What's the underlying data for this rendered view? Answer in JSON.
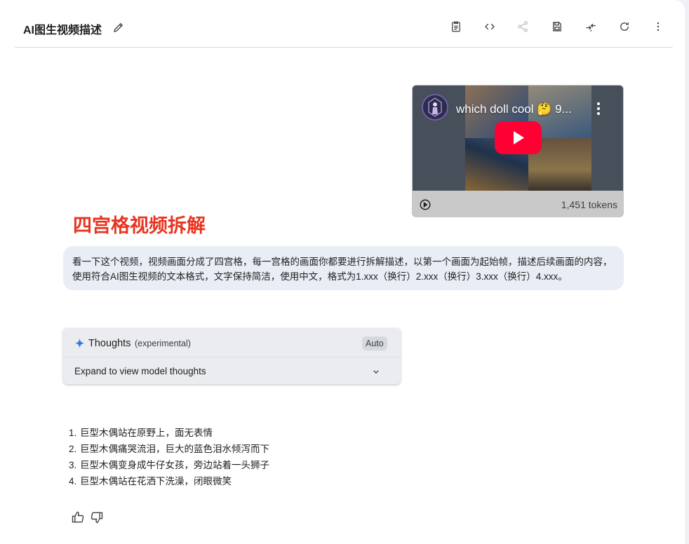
{
  "header": {
    "title": "AI图生视频描述",
    "toolbar_icons": [
      "clipboard-icon",
      "code-icon",
      "share-icon",
      "save-icon",
      "compare-icon",
      "refresh-icon",
      "more-vert-icon"
    ]
  },
  "video": {
    "title": "which doll cool 🤔 9...",
    "tokens": "1,451 tokens"
  },
  "heading": "四宫格视频拆解",
  "prompt": {
    "text": "看一下这个视频，视频画面分成了四宫格，每一宫格的画面你都要进行拆解描述，以第一个画面为起始帧，描述后续画面的内容，使用符合AI图生视频的文本格式，文字保持简洁，使用中文，格式为1.xxx（换行）2.xxx（换行）3.xxx（换行）4.xxx。"
  },
  "thoughts": {
    "label": "Thoughts",
    "sub": "(experimental)",
    "badge": "Auto",
    "expand": "Expand to view model thoughts"
  },
  "answer": {
    "items": [
      {
        "num": "1.",
        "text": "巨型木偶站在原野上，面无表情"
      },
      {
        "num": "2.",
        "text": "巨型木偶痛哭流泪，巨大的蓝色泪水倾泻而下"
      },
      {
        "num": "3.",
        "text": "巨型木偶变身成牛仔女孩，旁边站着一头狮子"
      },
      {
        "num": "4.",
        "text": "巨型木偶站在花洒下洗澡，闭眼微笑"
      }
    ]
  },
  "colors": {
    "heading": "#e8351f",
    "bubble": "#e9eef6",
    "play_red": "#ff0033"
  }
}
